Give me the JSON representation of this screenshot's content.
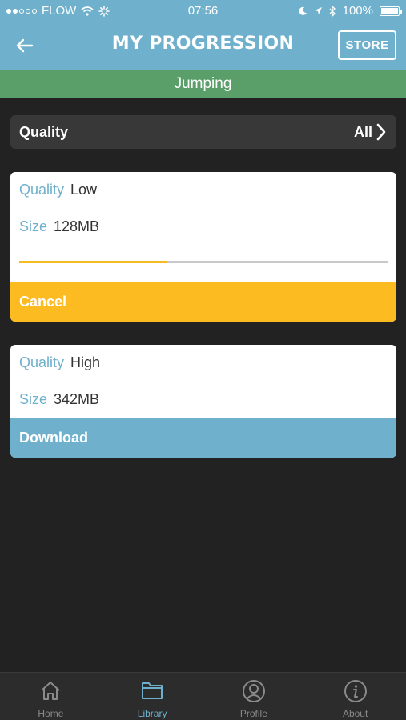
{
  "status_bar": {
    "carrier": "FLOW",
    "time": "07:56",
    "battery": "100%"
  },
  "header": {
    "title": "MY PROGRESSION",
    "store_label": "STORE"
  },
  "subheader": {
    "category": "Jumping"
  },
  "filter": {
    "label": "Quality",
    "value": "All"
  },
  "downloads": [
    {
      "quality_key": "Quality",
      "quality_value": "Low",
      "size_key": "Size",
      "size_value": "128MB",
      "progress_fraction": 0.4,
      "action_label": "Cancel",
      "action_color": "#fdbb22"
    },
    {
      "quality_key": "Quality",
      "quality_value": "High",
      "size_key": "Size",
      "size_value": "342MB",
      "action_label": "Download",
      "action_color": "#6fb0cc"
    }
  ],
  "tabs": [
    {
      "label": "Home",
      "icon": "home-icon",
      "active": false
    },
    {
      "label": "Library",
      "icon": "folder-icon",
      "active": true
    },
    {
      "label": "Profile",
      "icon": "profile-icon",
      "active": false
    },
    {
      "label": "About",
      "icon": "info-icon",
      "active": false
    }
  ],
  "colors": {
    "accent_blue": "#6fb0cc",
    "green_bar": "#5a9e69",
    "cancel_yellow": "#fdbb22",
    "background": "#222222"
  }
}
